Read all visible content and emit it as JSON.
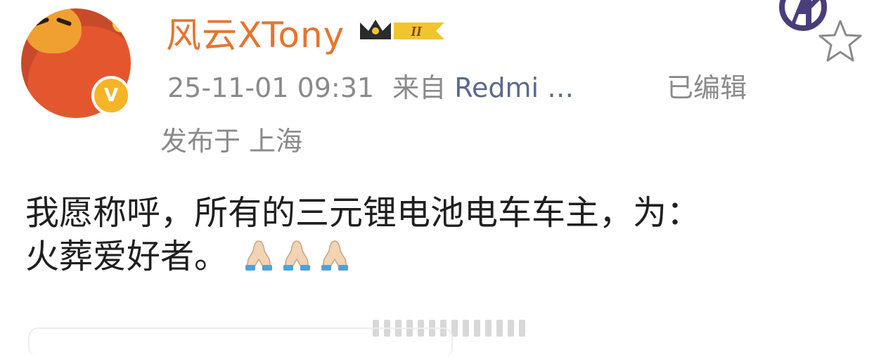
{
  "post": {
    "username": "风云XTony",
    "vip_level": "II",
    "timestamp": "25-11-01 09:31",
    "source_prefix": "来自",
    "source": "Redmi …",
    "edited_label": "已编辑",
    "location": "发布于 上海",
    "content_line1": "我愿称呼，所有的三元锂电池电车车主，为：",
    "content_line2": "火葬爱好者。",
    "emojis": [
      "folded-hands",
      "folded-hands",
      "folded-hands"
    ]
  },
  "colors": {
    "username": "#e8742c",
    "meta_text": "#8a8a8a",
    "source_link": "#5a6a8a",
    "verified_badge": "#f6b526",
    "body_text": "#1f1f1f"
  },
  "icons": {
    "verified": "verified-v-icon",
    "vip": "crown-vip-icon",
    "avengers": "avengers-logo-icon",
    "favorite": "star-outline-icon"
  }
}
